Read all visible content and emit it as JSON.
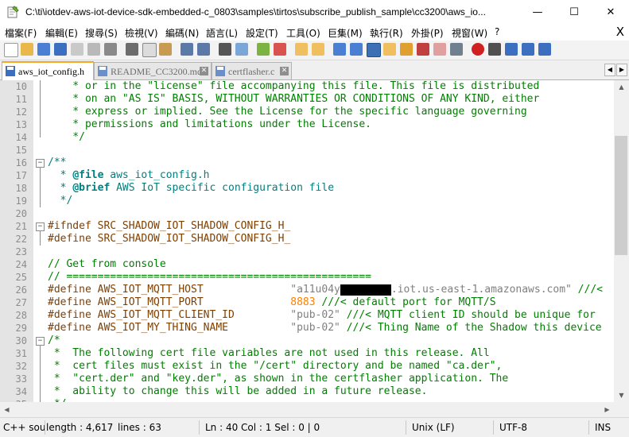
{
  "window": {
    "title": "C:\\ti\\iotdev-aws-iot-device-sdk-embedded-c_0803\\samples\\tirtos\\subscribe_publish_sample\\cc3200\\aws_io...",
    "minimize": "—",
    "maximize": "☐",
    "close": "✕"
  },
  "menu": {
    "items": [
      "檔案(F)",
      "編輯(E)",
      "搜尋(S)",
      "檢視(V)",
      "編碼(N)",
      "語言(L)",
      "設定(T)",
      "工具(O)",
      "巨集(M)",
      "執行(R)",
      "外掛(P)",
      "視窗(W)",
      "?"
    ],
    "close": "X"
  },
  "tabs": [
    {
      "label": "aws_iot_config.h",
      "active": true,
      "close": "✕"
    },
    {
      "label": "README_CC3200.md",
      "active": false,
      "close": "✕"
    },
    {
      "label": "certflasher.c",
      "active": false,
      "close": "✕"
    }
  ],
  "tab_nav": {
    "left": "◀",
    "right": "▶"
  },
  "editor": {
    "lines": [
      {
        "n": "10",
        "fold": "",
        "parts": [
          {
            "c": "c-com",
            "t": "    * or in the \"license\" file accompanying this file. This file is distributed"
          }
        ]
      },
      {
        "n": "11",
        "fold": "",
        "parts": [
          {
            "c": "c-com",
            "t": "    * on an \"AS IS\" BASIS, WITHOUT WARRANTIES OR CONDITIONS OF ANY KIND, either"
          }
        ]
      },
      {
        "n": "12",
        "fold": "",
        "parts": [
          {
            "c": "c-com",
            "t": "    * express or implied. See the License for the specific language governing"
          }
        ]
      },
      {
        "n": "13",
        "fold": "",
        "parts": [
          {
            "c": "c-com",
            "t": "    * permissions and limitations under the License."
          }
        ]
      },
      {
        "n": "14",
        "fold": "",
        "parts": [
          {
            "c": "c-com",
            "t": "    */"
          }
        ]
      },
      {
        "n": "15",
        "fold": "",
        "parts": []
      },
      {
        "n": "16",
        "fold": "−",
        "parts": [
          {
            "c": "c-doc",
            "t": "/**"
          }
        ]
      },
      {
        "n": "17",
        "fold": "",
        "parts": [
          {
            "c": "c-doc",
            "t": "  * "
          },
          {
            "c": "c-tag",
            "t": "@file"
          },
          {
            "c": "c-doc",
            "t": " aws_iot_config.h"
          }
        ]
      },
      {
        "n": "18",
        "fold": "",
        "parts": [
          {
            "c": "c-doc",
            "t": "  * "
          },
          {
            "c": "c-tag",
            "t": "@brief"
          },
          {
            "c": "c-doc",
            "t": " AWS IoT specific configuration file"
          }
        ]
      },
      {
        "n": "19",
        "fold": "",
        "parts": [
          {
            "c": "c-doc",
            "t": "  */"
          }
        ]
      },
      {
        "n": "20",
        "fold": "",
        "parts": []
      },
      {
        "n": "21",
        "fold": "−",
        "parts": [
          {
            "c": "c-pre",
            "t": "#ifndef SRC_SHADOW_IOT_SHADOW_CONFIG_H_"
          }
        ]
      },
      {
        "n": "22",
        "fold": "",
        "parts": [
          {
            "c": "c-pre",
            "t": "#define SRC_SHADOW_IOT_SHADOW_CONFIG_H_"
          }
        ]
      },
      {
        "n": "23",
        "fold": "",
        "parts": []
      },
      {
        "n": "24",
        "fold": "",
        "parts": [
          {
            "c": "c-com",
            "t": "// Get from console"
          }
        ]
      },
      {
        "n": "25",
        "fold": "",
        "parts": [
          {
            "c": "c-com",
            "t": "// ================================================="
          }
        ]
      },
      {
        "n": "26",
        "fold": "",
        "parts": [
          {
            "c": "c-pre",
            "t": "#define AWS_IOT_MQTT_HOST              "
          },
          {
            "c": "c-str",
            "t": "\"a11u04y"
          },
          {
            "c": "redact",
            "t": ""
          },
          {
            "c": "c-str",
            "t": ".iot.us-east-1.amazonaws.com\""
          },
          {
            "c": "c-com",
            "t": " ///<"
          }
        ]
      },
      {
        "n": "27",
        "fold": "",
        "parts": [
          {
            "c": "c-pre",
            "t": "#define AWS_IOT_MQTT_PORT              "
          },
          {
            "c": "c-num",
            "t": "8883"
          },
          {
            "c": "c-com",
            "t": " ///< default port for MQTT/S"
          }
        ]
      },
      {
        "n": "28",
        "fold": "",
        "parts": [
          {
            "c": "c-pre",
            "t": "#define AWS_IOT_MQTT_CLIENT_ID         "
          },
          {
            "c": "c-str",
            "t": "\"pub-02\""
          },
          {
            "c": "c-com",
            "t": " ///< MQTT client ID should be unique for"
          }
        ]
      },
      {
        "n": "29",
        "fold": "",
        "parts": [
          {
            "c": "c-pre",
            "t": "#define AWS_IOT_MY_THING_NAME          "
          },
          {
            "c": "c-str",
            "t": "\"pub-02\""
          },
          {
            "c": "c-com",
            "t": " ///< Thing Name of the Shadow this device"
          }
        ]
      },
      {
        "n": "30",
        "fold": "−",
        "parts": [
          {
            "c": "c-com",
            "t": "/*"
          }
        ]
      },
      {
        "n": "31",
        "fold": "",
        "parts": [
          {
            "c": "c-com",
            "t": " *  The following cert file variables are not used in this release. All"
          }
        ]
      },
      {
        "n": "32",
        "fold": "",
        "parts": [
          {
            "c": "c-com",
            "t": " *  cert files must exist in the \"/cert\" directory and be named \"ca.der\","
          }
        ]
      },
      {
        "n": "33",
        "fold": "",
        "parts": [
          {
            "c": "c-com",
            "t": " *  \"cert.der\" and \"key.der\", as shown in the certflasher application. The"
          }
        ]
      },
      {
        "n": "34",
        "fold": "",
        "parts": [
          {
            "c": "c-com",
            "t": " *  ability to change this will be added in a future release."
          }
        ]
      },
      {
        "n": "35",
        "fold": "",
        "parts": [
          {
            "c": "c-com",
            "t": " */"
          }
        ]
      }
    ]
  },
  "scroll": {
    "up": "▲",
    "down": "▼",
    "left": "◀",
    "right": "▶"
  },
  "status": {
    "filetype": "C++ sour",
    "length": "length : 4,617",
    "lines": "lines : 63",
    "position": "Ln : 40    Col : 1    Sel : 0 | 0",
    "eol": "Unix (LF)",
    "encoding": "UTF-8",
    "mode": "INS"
  },
  "colors": {
    "active_tab_accent": "#f5a623",
    "comment": "#008000",
    "preprocessor": "#804000",
    "number": "#ff8000"
  }
}
